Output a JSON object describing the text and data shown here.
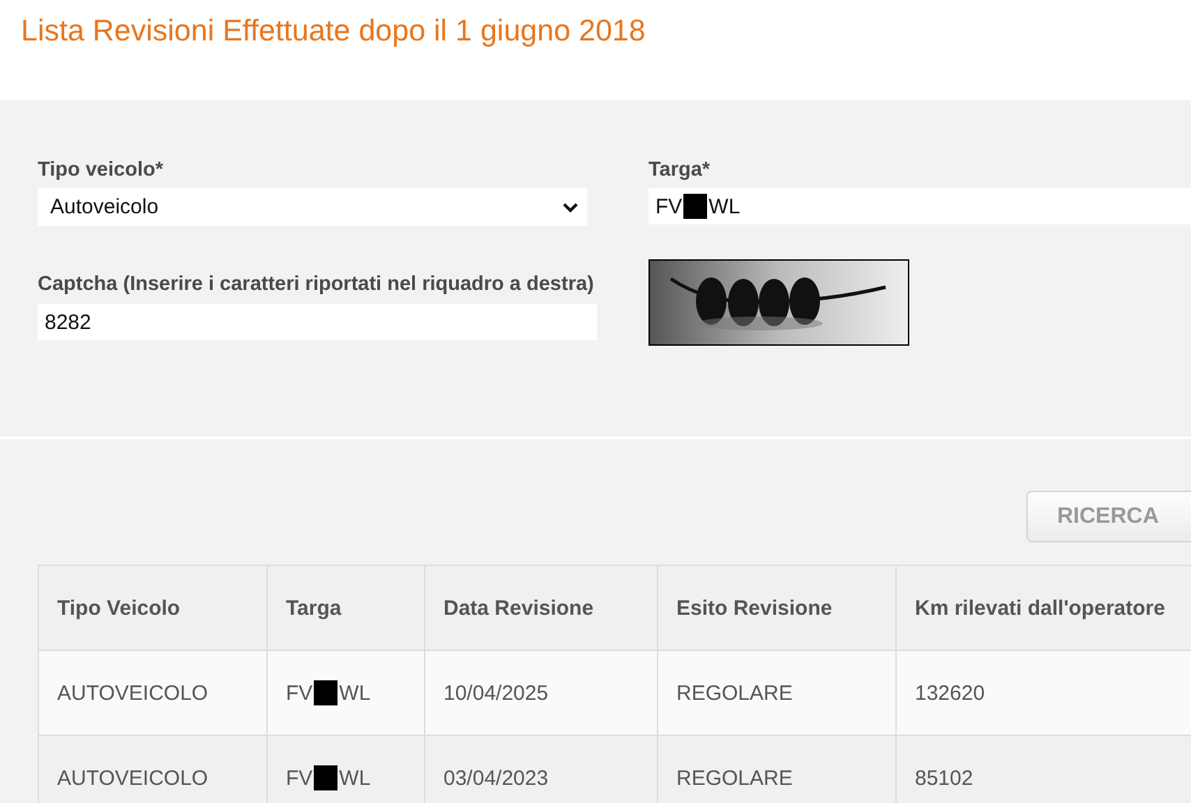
{
  "title": "Lista Revisioni Effettuate dopo il 1 giugno 2018",
  "form": {
    "vehicle_type": {
      "label": "Tipo veicolo*",
      "value": "Autoveicolo"
    },
    "plate": {
      "label": "Targa*",
      "value_before": "FV",
      "value_after": "WL"
    },
    "captcha": {
      "label": "Captcha (Inserire i caratteri riportati nel riquadro a destra)",
      "value": "8282"
    }
  },
  "search_button": "RICERCA",
  "table": {
    "columns": [
      "Tipo Veicolo",
      "Targa",
      "Data Revisione",
      "Esito Revisione",
      "Km rilevati dall'operatore"
    ],
    "rows": [
      {
        "vehicle_type": "AUTOVEICOLO",
        "plate_before": "FV",
        "plate_after": "WL",
        "date": "10/04/2025",
        "result": "REGOLARE",
        "km": "132620"
      },
      {
        "vehicle_type": "AUTOVEICOLO",
        "plate_before": "FV",
        "plate_after": "WL",
        "date": "03/04/2023",
        "result": "REGOLARE",
        "km": "85102"
      }
    ]
  }
}
